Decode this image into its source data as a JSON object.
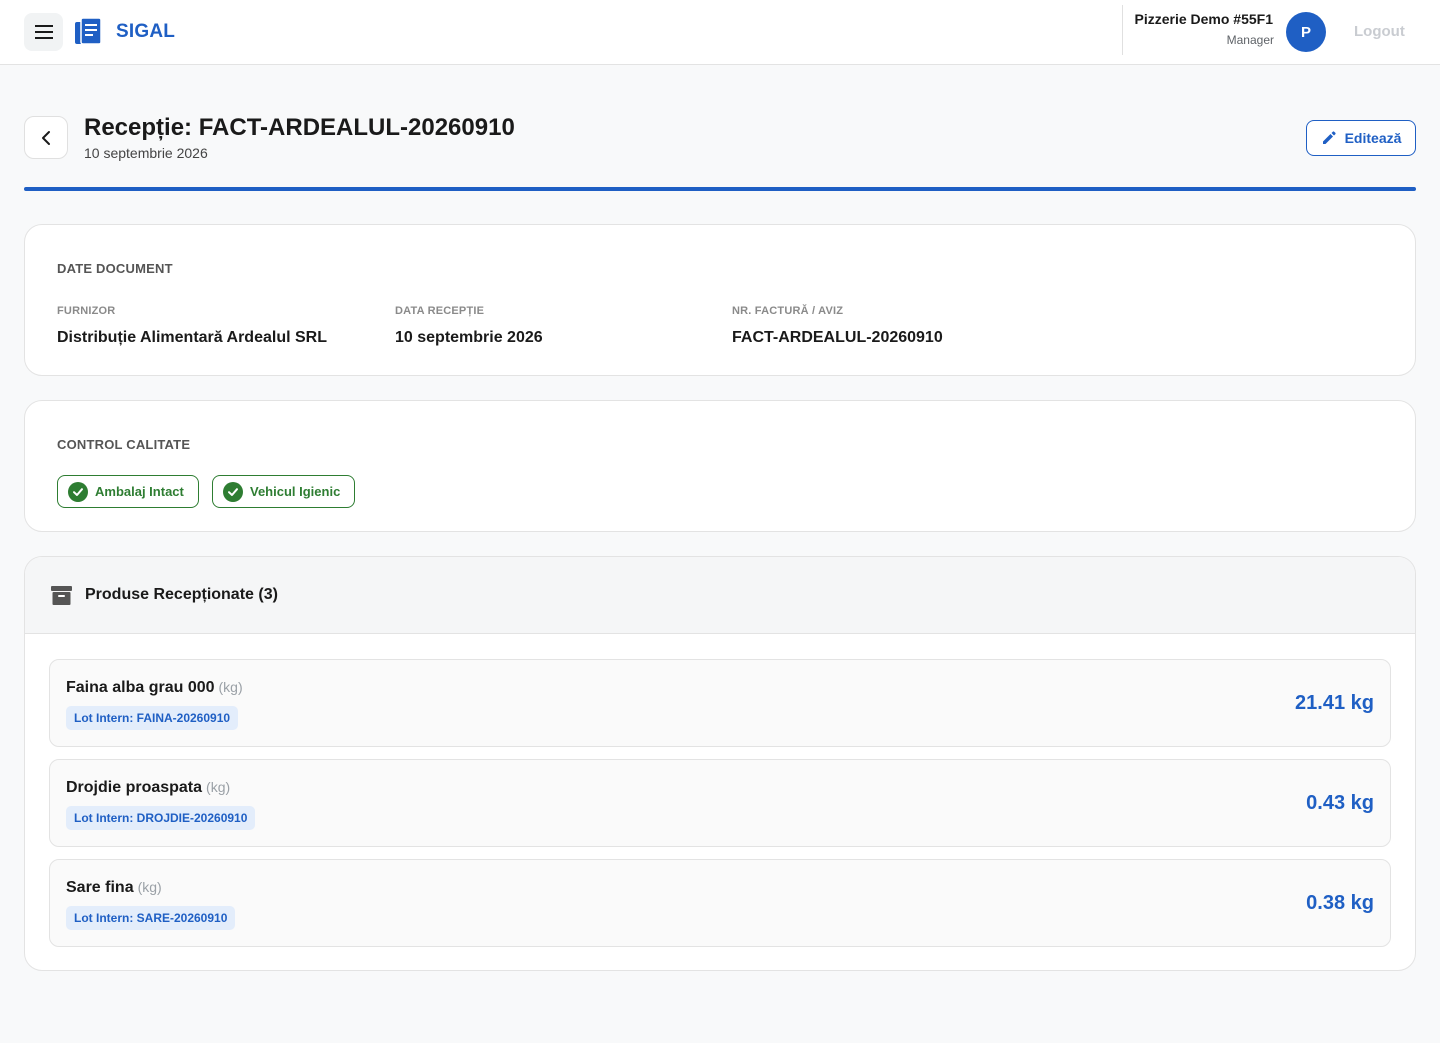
{
  "header": {
    "app_name": "SIGAL",
    "org_name": "Pizzerie Demo #55F1",
    "org_role": "Manager",
    "avatar_initial": "P",
    "logout_label": "Logout"
  },
  "page": {
    "title": "Recepție: FACT-ARDEALUL-20260910",
    "subtitle": "10 septembrie 2026",
    "edit_label": "Editează"
  },
  "document": {
    "section_title": "DATE DOCUMENT",
    "fields": [
      {
        "label": "FURNIZOR",
        "value": "Distribuție Alimentară Ardealul SRL"
      },
      {
        "label": "DATA RECEPȚIE",
        "value": "10 septembrie 2026"
      },
      {
        "label": "NR. FACTURĂ / AVIZ",
        "value": "FACT-ARDEALUL-20260910"
      }
    ]
  },
  "quality": {
    "section_title": "CONTROL CALITATE",
    "checks": [
      {
        "label": "Ambalaj Intact"
      },
      {
        "label": "Vehicul Igienic"
      }
    ]
  },
  "products": {
    "title": "Produse Recepționate (3)",
    "items": [
      {
        "name": "Faina alba grau 000",
        "unit": "(kg)",
        "lot": "Lot Intern: FAINA-20260910",
        "qty": "21.41 kg"
      },
      {
        "name": "Drojdie proaspata",
        "unit": "(kg)",
        "lot": "Lot Intern: DROJDIE-20260910",
        "qty": "0.43 kg"
      },
      {
        "name": "Sare fina",
        "unit": "(kg)",
        "lot": "Lot Intern: SARE-20260910",
        "qty": "0.38 kg"
      }
    ]
  },
  "colors": {
    "brand": "#1f5fc4",
    "success": "#2e7d32",
    "lot_badge_bg": "#e3edfb"
  },
  "icons": {
    "menu": "hamburger-menu-icon",
    "logo": "document-stack-icon",
    "back": "chevron-left-icon",
    "edit": "pencil-icon",
    "check": "check-circle-icon",
    "products": "archive-box-icon"
  }
}
